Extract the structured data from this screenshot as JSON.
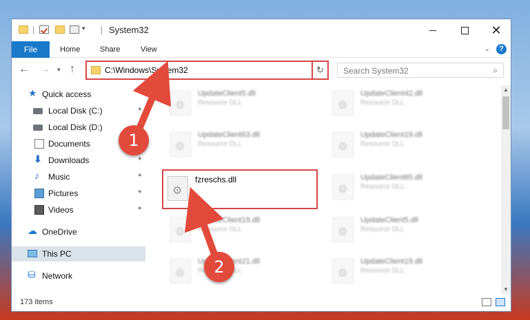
{
  "window": {
    "title": "System32",
    "title_controls": [
      "minimize",
      "maximize",
      "close"
    ]
  },
  "ribbon": {
    "tabs": [
      {
        "label": "File",
        "active": true
      },
      {
        "label": "Home"
      },
      {
        "label": "Share"
      },
      {
        "label": "View"
      }
    ],
    "help_label": "?"
  },
  "nav": {
    "address": "C:\\Windows\\System32",
    "search_placeholder": "Search System32",
    "refresh_icon": "↻",
    "search_icon": "⌕"
  },
  "sidebar": {
    "items": [
      {
        "label": "Quick access",
        "icon": "star-icon",
        "pinned": false
      },
      {
        "label": "Local Disk (C:)",
        "icon": "drive-icon",
        "pinned": true
      },
      {
        "label": "Local Disk (D:)",
        "icon": "drive-icon",
        "pinned": false
      },
      {
        "label": "Documents",
        "icon": "documents-icon",
        "pinned": true
      },
      {
        "label": "Downloads",
        "icon": "downloads-icon",
        "pinned": true
      },
      {
        "label": "Music",
        "icon": "music-icon",
        "pinned": true
      },
      {
        "label": "Pictures",
        "icon": "pictures-icon",
        "pinned": true
      },
      {
        "label": "Videos",
        "icon": "videos-icon",
        "pinned": true
      },
      {
        "label": "OneDrive",
        "icon": "onedrive-icon",
        "pinned": false
      },
      {
        "label": "This PC",
        "icon": "this-pc-icon",
        "pinned": false,
        "active": true
      },
      {
        "label": "Network",
        "icon": "network-icon",
        "pinned": false
      }
    ]
  },
  "files": {
    "left": [
      {
        "name": "UpdateClient5.dll",
        "type": "Resource DLL"
      },
      {
        "name": "UpdateClient63.dll",
        "type": "Resource DLL"
      },
      {
        "name": "fzreschs.dll",
        "type": "",
        "selected": true
      },
      {
        "name": "UpdateClient19.dll",
        "type": "Resource DLL"
      },
      {
        "name": "UpdateClient21.dll",
        "type": "Resource DLL"
      }
    ],
    "right": [
      {
        "name": "UpdateClient42.dll",
        "type": "Resource DLL"
      },
      {
        "name": "UpdateClient19.dll",
        "type": "Resource DLL"
      },
      {
        "name": "UpdateClient65.dll",
        "type": "Resource DLL"
      },
      {
        "name": "UpdateClient5.dll",
        "type": "Resource DLL"
      },
      {
        "name": "UpdateClient19.dll",
        "type": "Resource DLL"
      }
    ]
  },
  "status": {
    "item_count": "173 items"
  },
  "annotations": {
    "markers": [
      "1",
      "2"
    ],
    "color": "#e24a3b"
  },
  "colors": {
    "accent": "#1979ca",
    "highlight_box": "#d64545"
  }
}
